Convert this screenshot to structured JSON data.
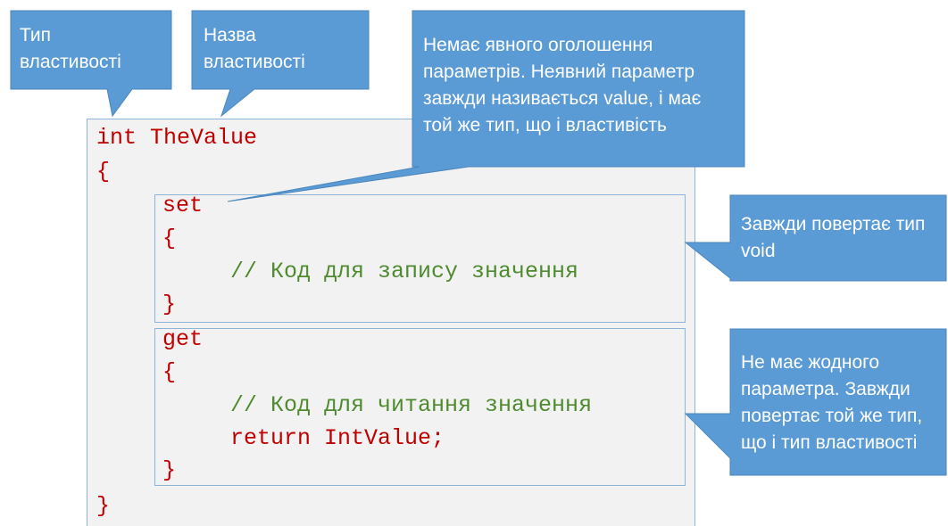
{
  "code": {
    "line1": "int TheValue",
    "open_brace": "{",
    "set_kw": "set",
    "set_open": "{",
    "set_comment": "// Код для запису значення",
    "set_close": "}",
    "get_kw": "get",
    "get_open": "{",
    "get_comment": "// Код для читання значення",
    "get_return": "return IntValue;",
    "get_close": "}",
    "close_brace": "}"
  },
  "callouts": {
    "type": {
      "line1": "Тип",
      "line2": "властивості"
    },
    "name": {
      "line1": "Назва",
      "line2": "властивості"
    },
    "set_param": {
      "line1": "Немає явного оголошення",
      "line2": "параметрів. Неявний параметр",
      "line3": "завжди називається value, і має",
      "line4": "той же тип, що і властивість"
    },
    "set_return": {
      "line1": "Завжди повертає тип",
      "line2": "void"
    },
    "get_info": {
      "line1": "Не має жодного",
      "line2": "параметра. Завжди",
      "line3": "повертає той же тип,",
      "line4": "що і тип властивості"
    }
  },
  "colors": {
    "callout_fill": "#5b9bd5",
    "keyword": "#c00000",
    "comment": "#4e8a2e",
    "code_bg": "#f2f2f2",
    "border": "#8eb4d8"
  }
}
